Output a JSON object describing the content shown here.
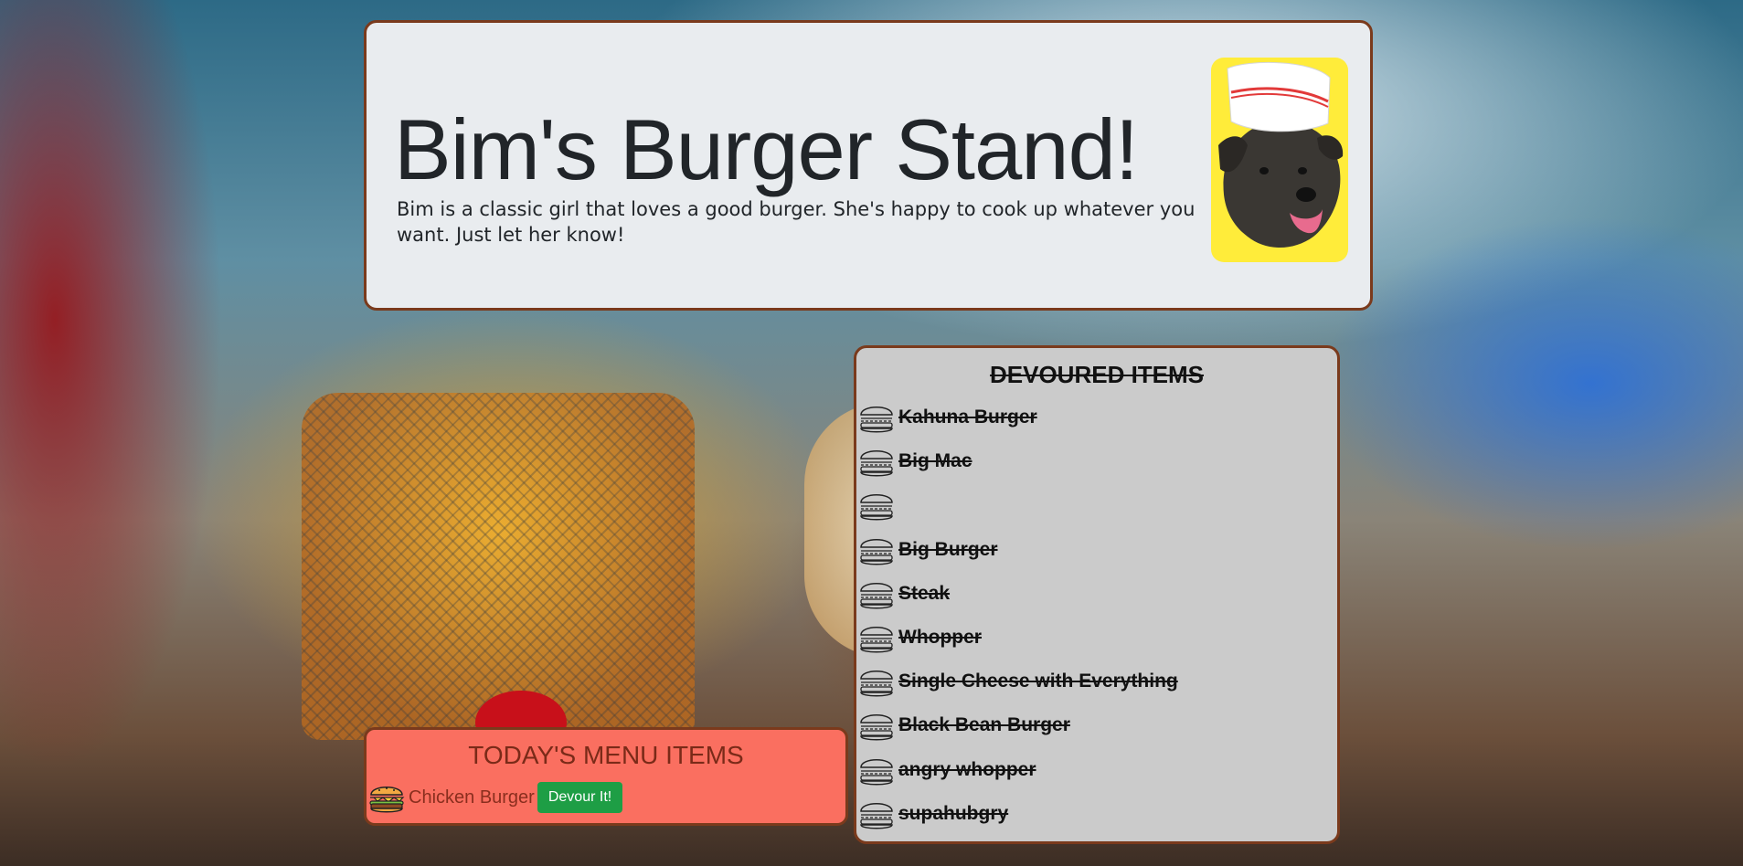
{
  "header": {
    "title": "Bim's Burger Stand!",
    "description": "Bim is a classic girl that loves a good burger. She's happy to cook up whatever you want. Just let her know!",
    "photo_icon": "dog-with-chef-hat"
  },
  "menu": {
    "heading": "TODAY'S MENU ITEMS",
    "items": [
      {
        "name": "Chicken Burger",
        "button_label": "Devour It!",
        "icon": "burger-icon"
      }
    ]
  },
  "devoured": {
    "heading": "DEVOURED ITEMS",
    "items": [
      "Kahuna Burger",
      "Big Mac",
      "",
      "Big Burger",
      "Steak",
      "Whopper",
      "Single Cheese with Everything",
      "Black Bean Burger",
      "angry whopper",
      "supahubgry"
    ]
  },
  "colors": {
    "header_bg": "#e9ecef",
    "menu_bg": "#fa6f60",
    "devoured_bg": "#cbcbcb",
    "border": "#7a3a1c",
    "button": "#1e9e45"
  }
}
